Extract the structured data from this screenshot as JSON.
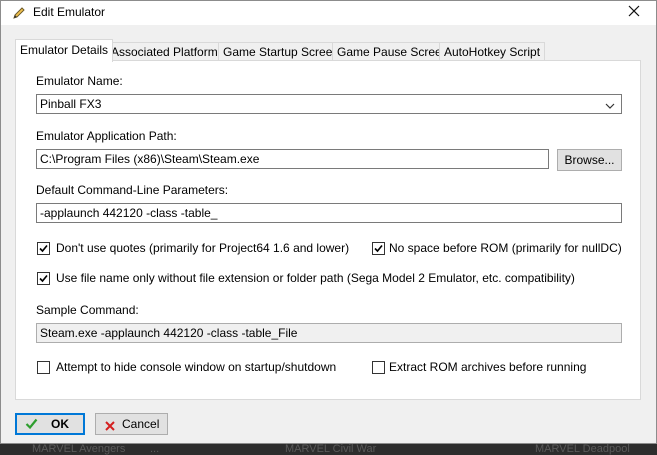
{
  "window": {
    "title": "Edit Emulator"
  },
  "tabs": [
    {
      "label": "Emulator Details",
      "active": true
    },
    {
      "label": "Associated Platforms"
    },
    {
      "label": "Game Startup Screen"
    },
    {
      "label": "Game Pause Screen"
    },
    {
      "label": "AutoHotkey Script"
    }
  ],
  "form": {
    "name_label": "Emulator Name:",
    "name_value": "Pinball FX3",
    "path_label": "Emulator Application Path:",
    "path_value": "C:\\Program Files (x86)\\Steam\\Steam.exe",
    "browse_label": "Browse...",
    "params_label": "Default Command-Line Parameters:",
    "params_value": "-applaunch 442120 -class -table_",
    "opt_no_quotes": {
      "label": "Don't use quotes (primarily for Project64 1.6 and lower)",
      "checked": true
    },
    "opt_no_space": {
      "label": "No space before ROM (primarily for nullDC)",
      "checked": true
    },
    "opt_filename_only": {
      "label": "Use file name only without file extension or folder path (Sega Model 2 Emulator, etc. compatibility)",
      "checked": true
    },
    "sample_label": "Sample Command:",
    "sample_value": "Steam.exe -applaunch 442120 -class -table_File",
    "opt_hide_console": {
      "label": "Attempt to hide console window on startup/shutdown",
      "checked": false
    },
    "opt_extract_rom": {
      "label": "Extract ROM archives before running",
      "checked": false
    }
  },
  "buttons": {
    "ok": "OK",
    "cancel": "Cancel"
  },
  "background": [
    "MARVEL  Avengers",
    "...",
    "MARVEL  Civil War",
    "MARVEL  Deadpool"
  ],
  "colors": {
    "accent": "#0078d7",
    "ok_check": "#2e9e2e",
    "cancel_x": "#d42020"
  }
}
